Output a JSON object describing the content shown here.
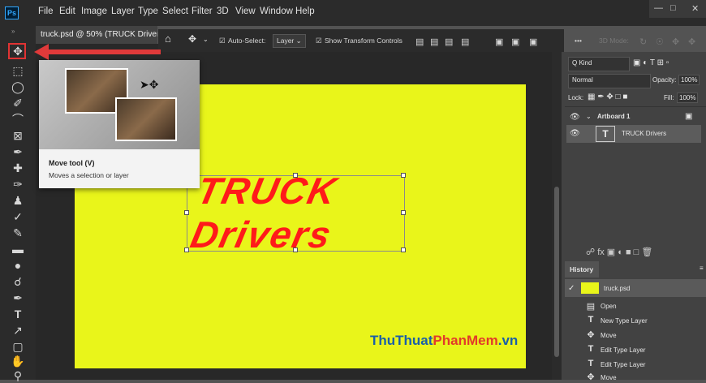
{
  "app": {
    "logo": "Ps"
  },
  "menu": [
    "File",
    "Edit",
    "Image",
    "Layer",
    "Type",
    "Select",
    "Filter",
    "3D",
    "View",
    "Window",
    "Help"
  ],
  "document": {
    "tab_title": "truck.psd @ 50% (TRUCK Drivers,"
  },
  "options_bar": {
    "auto_select_label": "Auto-Select:",
    "auto_select_value": "Layer",
    "show_transform_label": "Show Transform Controls",
    "more": "•••",
    "mode_3d": "3D Mode:"
  },
  "tooltip": {
    "title": "Move tool (V)",
    "description": "Moves a selection or layer"
  },
  "canvas": {
    "line1": "TRUCK",
    "line2": "Drivers",
    "artboard_color": "#e9f51a",
    "text_color": "#ff1a1a"
  },
  "layers": {
    "filter": "Q Kind",
    "blend_mode": "Normal",
    "opacity_label": "Opacity:",
    "opacity_value": "100%",
    "lock_label": "Lock:",
    "fill_label": "Fill:",
    "fill_value": "100%",
    "artboard_name": "Artboard 1",
    "layer_name": "TRUCK Drivers"
  },
  "history": {
    "tab": "History",
    "snapshot": "truck.psd",
    "items": [
      "Open",
      "New Type Layer",
      "Move",
      "Edit Type Layer",
      "Edit Type Layer",
      "Move"
    ]
  },
  "watermark": {
    "part1": "ThuThuat",
    "part2": "PhanMem",
    "part3": ".vn"
  }
}
